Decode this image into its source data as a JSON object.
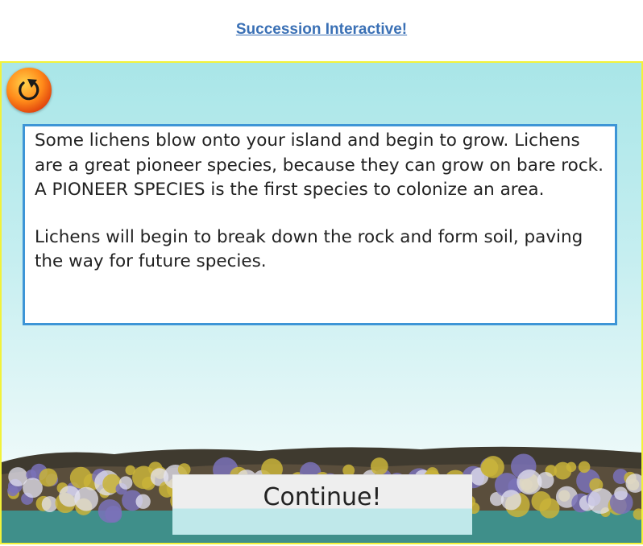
{
  "header": {
    "link_text": "Succession Interactive!"
  },
  "interactive": {
    "restart_icon": "restart-icon",
    "paragraphs": [
      "Some lichens blow onto your island and begin to grow. Lichens are a great pioneer species, because they can grow on bare rock.   A PIONEER SPECIES is the first species to colonize an area.",
      "Lichens will begin to break down the rock and form soil, paving the way for future species."
    ],
    "continue_label": "Continue!"
  },
  "colors": {
    "link": "#3a70b5",
    "frame_border": "#f2f23a",
    "textbox_border": "#3d95d6",
    "sky": "#a9e6e8",
    "lichen_yellow": "#c9b43a",
    "lichen_purple": "#7a72b8"
  }
}
